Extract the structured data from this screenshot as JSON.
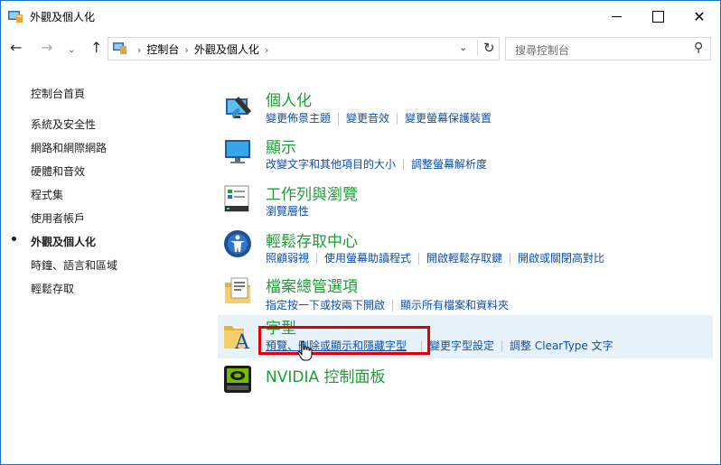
{
  "window": {
    "title": "外觀及個人化"
  },
  "nav": {
    "breadcrumbs": [
      "控制台",
      "外觀及個人化"
    ],
    "search_placeholder": "搜尋控制台"
  },
  "sidebar": {
    "home": "控制台首頁",
    "items": [
      {
        "label": "系統及安全性",
        "selected": false
      },
      {
        "label": "網路和網際網路",
        "selected": false
      },
      {
        "label": "硬體和音效",
        "selected": false
      },
      {
        "label": "程式集",
        "selected": false
      },
      {
        "label": "使用者帳戶",
        "selected": false
      },
      {
        "label": "外觀及個人化",
        "selected": true
      },
      {
        "label": "時鐘、語言和區域",
        "selected": false
      },
      {
        "label": "輕鬆存取",
        "selected": false
      }
    ]
  },
  "categories": [
    {
      "title": "個人化",
      "icon": "personalization-icon",
      "links": [
        "變更佈景主題",
        "變更音效",
        "變更螢幕保護裝置"
      ]
    },
    {
      "title": "顯示",
      "icon": "display-icon",
      "links": [
        "改變文字和其他項目的大小",
        "調整螢幕解析度"
      ]
    },
    {
      "title": "工作列與瀏覽",
      "icon": "taskbar-icon",
      "links": [
        "瀏覽層性"
      ]
    },
    {
      "title": "輕鬆存取中心",
      "icon": "ease-of-access-icon",
      "links": [
        "照顧弱視",
        "使用螢幕助讀程式",
        "開啟輕鬆存取鍵",
        "開啟或關閉高對比"
      ]
    },
    {
      "title": "檔案總管選項",
      "icon": "file-explorer-options-icon",
      "links": [
        "指定按一下或按兩下開啟",
        "顯示所有檔案和資料夾"
      ]
    },
    {
      "title": "字型",
      "icon": "fonts-icon",
      "links": [
        "預覽、刪除或顯示和隱藏字型",
        "變更字型設定",
        "調整 ClearType 文字"
      ]
    },
    {
      "title": "NVIDIA 控制面板",
      "icon": "nvidia-icon",
      "links": []
    }
  ],
  "colors": {
    "category_title": "#1e9e36",
    "link": "#0f4ea8",
    "highlight_box": "#e00000",
    "hover_bg": "#e7f2fb"
  }
}
